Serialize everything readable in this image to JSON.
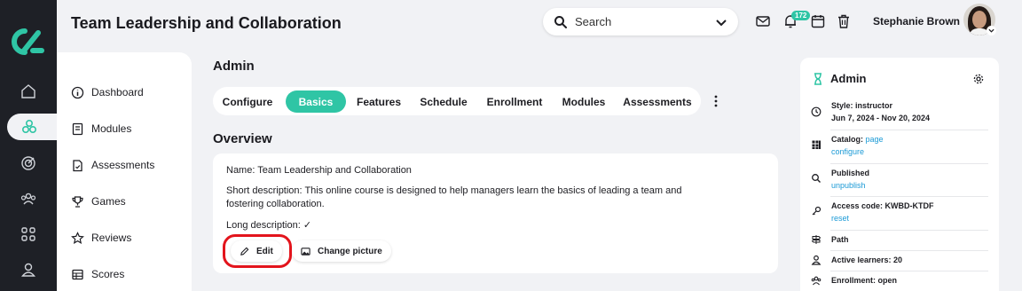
{
  "header": {
    "title": "Team Leadership and Collaboration",
    "search_label": "Search",
    "notification_count": "172",
    "user_name": "Stephanie Brown"
  },
  "rail": {
    "items": [
      "home-icon",
      "courses-icon",
      "target-icon",
      "users-icon",
      "grid-icon",
      "profile-icon"
    ],
    "active_index": 1
  },
  "sidebar": {
    "items": [
      {
        "label": "Dashboard",
        "icon": "info-icon"
      },
      {
        "label": "Modules",
        "icon": "book-icon"
      },
      {
        "label": "Assessments",
        "icon": "clipboard-icon"
      },
      {
        "label": "Games",
        "icon": "trophy-icon"
      },
      {
        "label": "Reviews",
        "icon": "star-icon"
      },
      {
        "label": "Scores",
        "icon": "table-icon"
      }
    ]
  },
  "main": {
    "admin_title": "Admin",
    "tabs": [
      {
        "label": "Configure"
      },
      {
        "label": "Basics",
        "active": true
      },
      {
        "label": "Features"
      },
      {
        "label": "Schedule"
      },
      {
        "label": "Enrollment"
      },
      {
        "label": "Modules"
      },
      {
        "label": "Assessments"
      }
    ],
    "overview_title": "Overview",
    "name_line": "Name: Team Leadership and Collaboration",
    "short_desc_line1": "Short description: This online course is designed to help managers learn the basics of leading a team and",
    "short_desc_line2": "fostering collaboration.",
    "long_desc_line": "Long description: ✓",
    "edit_label": "Edit",
    "change_picture_label": "Change picture"
  },
  "right_panel": {
    "title": "Admin",
    "style_label": "Style: instructor",
    "dates": "Jun 7, 2024 - Nov 20, 2024",
    "catalog_label": "Catalog:",
    "catalog_link1": "page",
    "catalog_link2": "configure",
    "published_label": "Published",
    "unpublish_link": "unpublish",
    "access_code_label": "Access code: KWBD-KTDF",
    "reset_link": "reset",
    "path_label": "Path",
    "active_learners_label": "Active learners: 20",
    "enrollment_label": "Enrollment: open"
  },
  "colors": {
    "accent": "#2fc5a5",
    "rail": "#1e2026",
    "link": "#1b9ad6",
    "annotation": "#e3141c"
  }
}
